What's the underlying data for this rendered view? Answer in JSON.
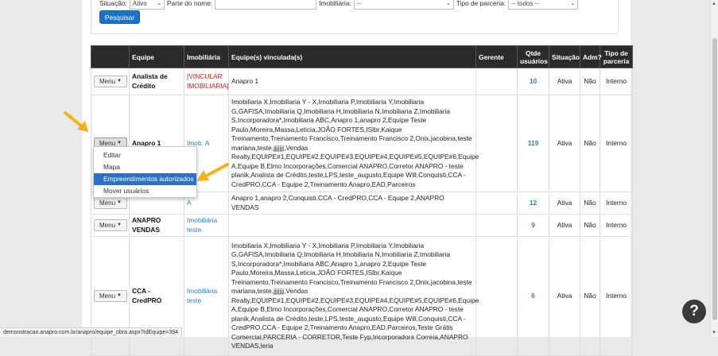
{
  "filters": {
    "situacao_label": "Situação:",
    "situacao_value": "Ativo",
    "nome_label": "Parte do nome:",
    "imobiliaria_label": "Imobiliária:",
    "imobiliaria_value": "--",
    "parceria_label": "Tipo de parceria:",
    "parceria_value": "-- todos --",
    "search_button": "Pesquisar"
  },
  "table": {
    "headers": {
      "equipe": "Equipe",
      "imobiliaria": "Imobiliária",
      "vinculadas": "Equipe(s) vinculada(s)",
      "gerente": "Gerente",
      "qtde": "Qtde usuários",
      "situacao": "Situação",
      "adm": "Adm?",
      "tipo": "Tipo de parceria"
    },
    "rows": [
      {
        "menu": "Menu",
        "equipe": "Analista de Crédito",
        "imobiliaria": "[VINCULAR IMOBILIARIA]",
        "vinculadas": "Anapro 1",
        "gerente": "",
        "qtde": "10",
        "situacao": "Ativa",
        "adm": "Não",
        "tipo": "Interno"
      },
      {
        "menu": "Menu",
        "equipe": "Anapro 1",
        "imobiliaria": "Imob. A",
        "vinculadas": "Imobiliaria X,Imobiliaria Y - X,Imobiliaria P,Imobiliaria Y,Imobiliaria G,GAFISA,Imobiliaria Q,Imobiliaria H,Imobiliaria N,Imobiliaria Z,Imobiliaria S,Incorporadora*,Imobiliaria ABC,Anapro 1,anapro 2,Equipe Teste Paulo,Moreira,Massa,Leticia,JOÃO FORTES,ISlbr,Kaique Treinamento,Treinamento Francisco,Treinamento Francisco 2,Onix,jacobina,teste mariana,teste,jjjjjjj,Vendas Realty,EQUIPE#1,EQUIPE#2,EQUIPE#3,EQUIPE#4,EQUIPE#5,EQUIPE#6,Equipe A,Equipe B,Elmo Incorporações,Comercial ANAPRO,Corretor ANAPRO - teste planik,Analista de Crédito,teste,LPS,teste_augusto,Equipe Will,Conquisti,CCA - CredPRO,CCA - Equipe 2,Treinamento Anapro,EAD,Parceiros",
        "gerente": "",
        "qtde": "119",
        "situacao": "Ativa",
        "adm": "Não",
        "tipo": "Interno"
      },
      {
        "menu": "Menu",
        "equipe": "",
        "imobiliaria": "A",
        "vinculadas": "Anapro 1,anapro 2,Conquisti,CCA - CredPRO,CCA - Equipe 2,ANAPRO VENDAS",
        "gerente": "",
        "qtde": "12",
        "situacao": "Ativa",
        "adm": "Não",
        "tipo": "Interno"
      },
      {
        "menu": "Menu",
        "equipe": "ANAPRO VENDAS",
        "imobiliaria": "Imobiliária teste",
        "vinculadas": "",
        "gerente": "",
        "qtde": "9",
        "situacao": "Ativa",
        "adm": "Não",
        "tipo": "Interno"
      },
      {
        "menu": "Menu",
        "equipe": "CCA - CredPRO",
        "imobiliaria": "Imobiliária teste",
        "vinculadas": "Imobiliaria X,Imobiliaria Y - X,Imobiliaria P,Imobiliaria Y,Imobiliaria G,GAFISA,Imobiliaria Q,Imobiliaria H,Imobiliaria N,Imobiliaria Z,Imobiliaria S,Incorporadora*,Imobiliaria ABC,Anapro 1,anapro 2,Equipe Teste Paulo,Moreira,Massa,Leticia,JOÃO FORTES,ISlbr,Kaique Treinamento,Treinamento Francisco,Treinamento Francisco 2,Onix,jacobina,teste mariana,teste,jjjjjjj,Vendas Realty,EQUIPE#1,EQUIPE#2,EQUIPE#3,EQUIPE#4,EQUIPE#5,EQUIPE#6,Equipe A,Equipe B,Elmo Incorporações,Comercial ANAPRO,Corretor ANAPRO - teste planik,Analista de Crédito,teste,LPS,teste_augusto,Equipe Will,Conquisti,CCA - CredPRO,CCA - Equipe 2,Treinamento Anapro,EAD,Parceiros,Teste Grátis Comercial,PARCERIA - CORRETOR,Teste Fyp,Incorporadora Correia,ANAPRO VENDAS,leria",
        "gerente": "",
        "qtde": "6",
        "situacao": "Ativa",
        "adm": "Não",
        "tipo": "Interno"
      }
    ]
  },
  "dropdown": {
    "items": [
      "Editar",
      "Mapa",
      "Empreendimentos autorizados",
      "Mover usuários"
    ],
    "selected_index": 2
  },
  "statusbar": "demonstracao.anapro.com.br/anapro/equipe_obra.aspx?IdEquipe=394",
  "help": "?",
  "colors": {
    "header_bg": "#2b2b2b",
    "link": "#2a7fc4",
    "primary": "#1a73c9",
    "highlight": "#2f6fc4",
    "arrow": "#f2b21c"
  }
}
